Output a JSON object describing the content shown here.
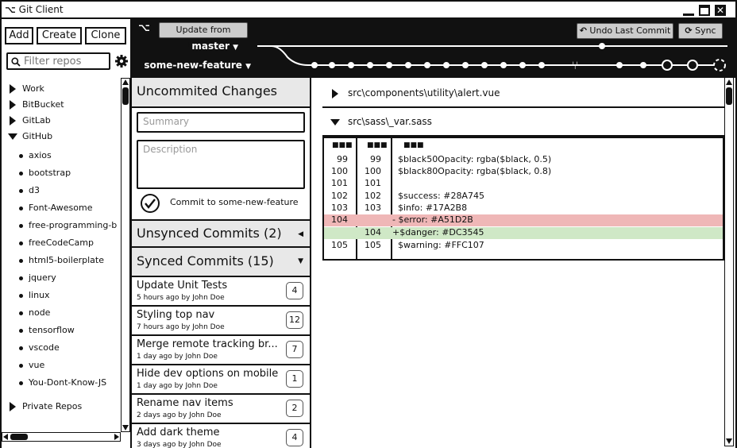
{
  "window": {
    "title": "Git Client"
  },
  "toolbar": {
    "add": "Add",
    "create": "Create",
    "clone": "Clone"
  },
  "filter": {
    "placeholder": "Filter repos"
  },
  "gitbar": {
    "update_from_master": "Update from master",
    "undo_last_commit": "Undo Last Commit",
    "sync": "Sync",
    "branch_master": "master",
    "branch_feature": "some-new-feature"
  },
  "sidebar": {
    "groups": [
      {
        "label": "Work",
        "expanded": false
      },
      {
        "label": "BitBucket",
        "expanded": false
      },
      {
        "label": "GitLab",
        "expanded": false
      },
      {
        "label": "GitHub",
        "expanded": true
      }
    ],
    "repos": [
      "axios",
      "bootstrap",
      "d3",
      "Font-Awesome",
      "free-programming-b",
      "freeCodeCamp",
      "html5-boilerplate",
      "jquery",
      "linux",
      "node",
      "tensorflow",
      "vscode",
      "vue",
      "You-Dont-Know-JS"
    ],
    "private": "Private Repos"
  },
  "changes": {
    "header": "Uncommited Changes",
    "summary_placeholder": "Summary",
    "description_placeholder": "Description",
    "commit_label": "Commit to some-new-feature",
    "unsynced": "Unsynced Commits (2)",
    "synced": "Synced Commits (15)"
  },
  "commits": [
    {
      "title": "Update Unit Tests",
      "meta": "5 hours ago by John Doe",
      "count": "4"
    },
    {
      "title": "Styling top nav",
      "meta": "7 hours ago by John Doe",
      "count": "12"
    },
    {
      "title": "Merge remote tracking br...",
      "meta": "1 day ago by John Doe",
      "count": "7"
    },
    {
      "title": "Hide dev options on mobile",
      "meta": "1 day ago by John Doe",
      "count": "1"
    },
    {
      "title": "Rename nav items",
      "meta": "2 days ago by John Doe",
      "count": "2"
    },
    {
      "title": "Add dark theme",
      "meta": "3 days ago by John Doe",
      "count": "4"
    }
  ],
  "files": [
    {
      "path": "src\\components\\utility\\alert.vue",
      "expanded": false
    },
    {
      "path": "src\\sass\\_var.sass",
      "expanded": true
    }
  ],
  "diff": {
    "header_marker": "■■■",
    "lines": [
      {
        "old": "99",
        "new": "99",
        "code": "  $black50Opacity: rgba($black, 0.5)",
        "kind": "ctx"
      },
      {
        "old": "100",
        "new": "100",
        "code": "  $black80Opacity: rgba($black, 0.8)",
        "kind": "ctx"
      },
      {
        "old": "101",
        "new": "101",
        "code": "",
        "kind": "ctx"
      },
      {
        "old": "102",
        "new": "102",
        "code": "  $success: #28A745",
        "kind": "ctx"
      },
      {
        "old": "103",
        "new": "103",
        "code": "  $info: #17A2B8",
        "kind": "ctx"
      },
      {
        "old": "104",
        "new": "",
        "code": "- $error: #A51D2B",
        "kind": "del"
      },
      {
        "old": "",
        "new": "104",
        "code": "+$danger: #DC3545",
        "kind": "add"
      },
      {
        "old": "105",
        "new": "105",
        "code": "  $warning: #FFC107",
        "kind": "ctx"
      }
    ]
  },
  "colors": {
    "deleted": "#efb7b7",
    "added": "#cfe8c6",
    "toolbar": "#111111"
  }
}
